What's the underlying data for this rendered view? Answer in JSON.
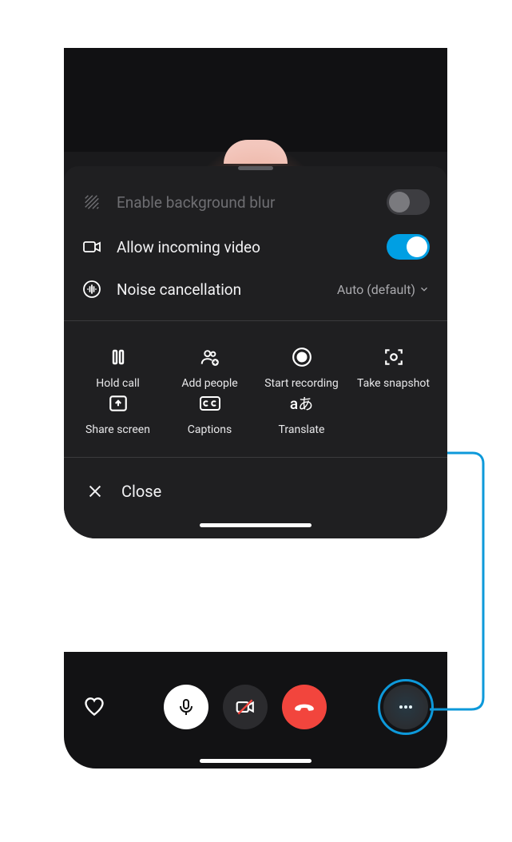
{
  "settings": {
    "blur": {
      "label": "Enable background blur",
      "on": false,
      "disabled": true
    },
    "video": {
      "label": "Allow incoming video",
      "on": true
    },
    "noise": {
      "label": "Noise cancellation",
      "value": "Auto (default)"
    }
  },
  "actions": [
    {
      "label": "Hold call",
      "icon": "pause-icon"
    },
    {
      "label": "Add people",
      "icon": "add-people-icon"
    },
    {
      "label": "Start recording",
      "icon": "record-icon"
    },
    {
      "label": "Take snapshot",
      "icon": "snapshot-icon"
    },
    {
      "label": "Share screen",
      "icon": "share-screen-icon"
    },
    {
      "label": "Captions",
      "icon": "captions-icon"
    },
    {
      "label": "Translate",
      "icon": "translate-icon"
    }
  ],
  "close_label": "Close",
  "callbar": {
    "mic": "mic",
    "camera": "camera-off",
    "hangup": "hangup",
    "more": "more"
  },
  "colors": {
    "accent": "#009fe3",
    "hangup": "#f2453d",
    "highlight": "#0d99da"
  }
}
